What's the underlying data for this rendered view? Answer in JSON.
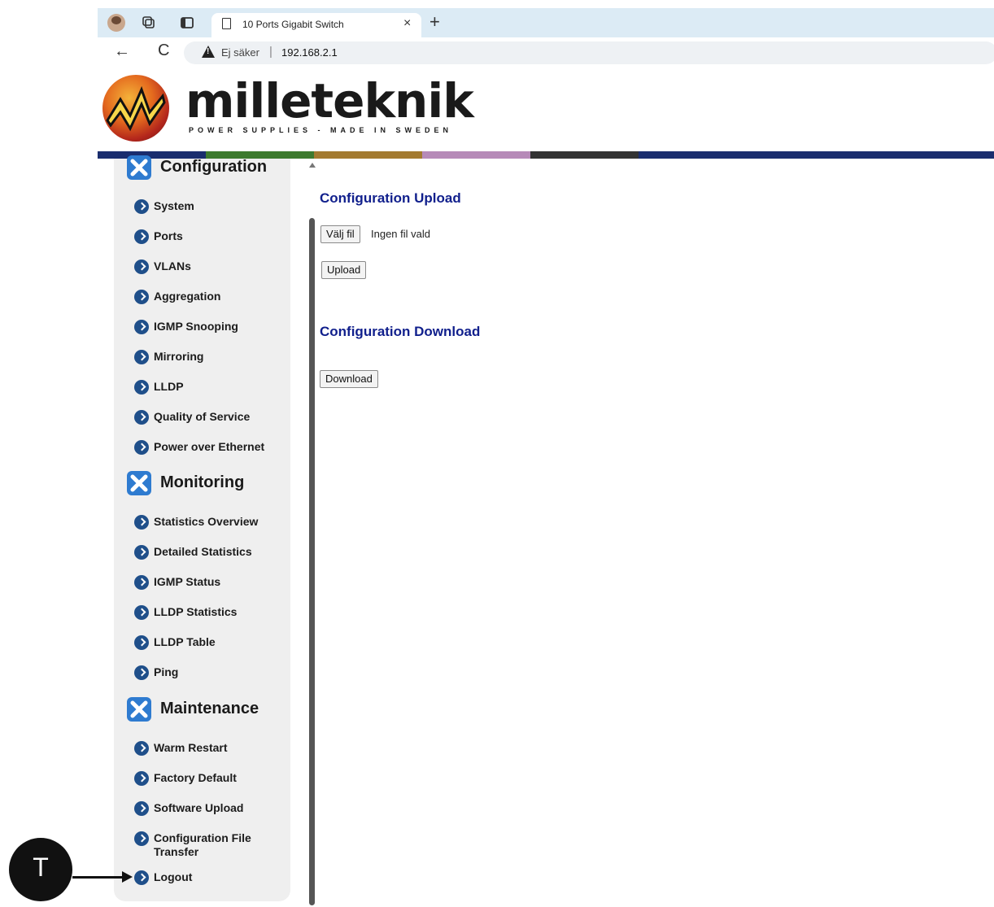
{
  "browser": {
    "tab_title": "10 Ports Gigabit Switch",
    "tab_close": "×",
    "new_tab": "+",
    "back": "←",
    "reload": "C",
    "security_label": "Ej säker",
    "separator": "|",
    "url": "192.168.2.1"
  },
  "header": {
    "logo_text": "milleteknik",
    "logo_tagline": "POWER SUPPLIES - MADE IN SWEDEN",
    "stripe_colors": [
      "#1a2d6e",
      "#3d7a2e",
      "#a37a2f",
      "#b68ab8",
      "#333333",
      "#1a2d6e"
    ]
  },
  "sidebar": {
    "sections": [
      {
        "title": "Configuration",
        "items": [
          "System",
          "Ports",
          "VLANs",
          "Aggregation",
          "IGMP Snooping",
          "Mirroring",
          "LLDP",
          "Quality of Service",
          "Power over Ethernet"
        ]
      },
      {
        "title": "Monitoring",
        "items": [
          "Statistics Overview",
          "Detailed Statistics",
          "IGMP Status",
          "LLDP Statistics",
          "LLDP Table",
          "Ping"
        ]
      },
      {
        "title": "Maintenance",
        "items": [
          "Warm Restart",
          "Factory Default",
          "Software Upload",
          "Configuration File Transfer",
          "Logout"
        ]
      }
    ]
  },
  "main": {
    "upload_heading": "Configuration Upload",
    "choose_file_label": "Välj fil",
    "no_file_text": "Ingen fil vald",
    "upload_button": "Upload",
    "download_heading": "Configuration Download",
    "download_button": "Download"
  },
  "annotation": {
    "marker_label": "T"
  }
}
